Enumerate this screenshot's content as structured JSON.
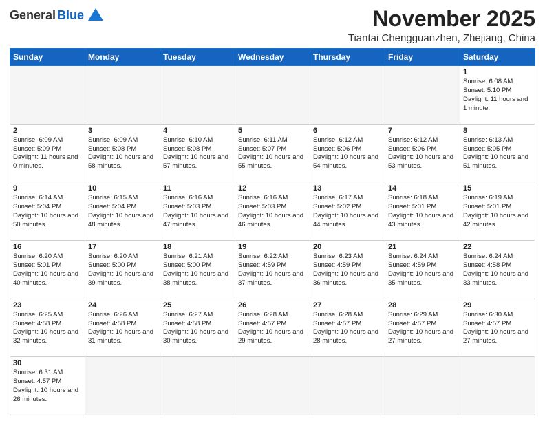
{
  "logo": {
    "general": "General",
    "blue": "Blue"
  },
  "header": {
    "month": "November 2025",
    "location": "Tiantai Chengguanzhen, Zhejiang, China"
  },
  "weekdays": [
    "Sunday",
    "Monday",
    "Tuesday",
    "Wednesday",
    "Thursday",
    "Friday",
    "Saturday"
  ],
  "weeks": [
    [
      {
        "day": "",
        "info": ""
      },
      {
        "day": "",
        "info": ""
      },
      {
        "day": "",
        "info": ""
      },
      {
        "day": "",
        "info": ""
      },
      {
        "day": "",
        "info": ""
      },
      {
        "day": "",
        "info": ""
      },
      {
        "day": "1",
        "info": "Sunrise: 6:08 AM\nSunset: 5:10 PM\nDaylight: 11 hours and 1 minute."
      }
    ],
    [
      {
        "day": "2",
        "info": "Sunrise: 6:09 AM\nSunset: 5:09 PM\nDaylight: 11 hours and 0 minutes."
      },
      {
        "day": "3",
        "info": "Sunrise: 6:09 AM\nSunset: 5:08 PM\nDaylight: 10 hours and 58 minutes."
      },
      {
        "day": "4",
        "info": "Sunrise: 6:10 AM\nSunset: 5:08 PM\nDaylight: 10 hours and 57 minutes."
      },
      {
        "day": "5",
        "info": "Sunrise: 6:11 AM\nSunset: 5:07 PM\nDaylight: 10 hours and 55 minutes."
      },
      {
        "day": "6",
        "info": "Sunrise: 6:12 AM\nSunset: 5:06 PM\nDaylight: 10 hours and 54 minutes."
      },
      {
        "day": "7",
        "info": "Sunrise: 6:12 AM\nSunset: 5:06 PM\nDaylight: 10 hours and 53 minutes."
      },
      {
        "day": "8",
        "info": "Sunrise: 6:13 AM\nSunset: 5:05 PM\nDaylight: 10 hours and 51 minutes."
      }
    ],
    [
      {
        "day": "9",
        "info": "Sunrise: 6:14 AM\nSunset: 5:04 PM\nDaylight: 10 hours and 50 minutes."
      },
      {
        "day": "10",
        "info": "Sunrise: 6:15 AM\nSunset: 5:04 PM\nDaylight: 10 hours and 48 minutes."
      },
      {
        "day": "11",
        "info": "Sunrise: 6:16 AM\nSunset: 5:03 PM\nDaylight: 10 hours and 47 minutes."
      },
      {
        "day": "12",
        "info": "Sunrise: 6:16 AM\nSunset: 5:03 PM\nDaylight: 10 hours and 46 minutes."
      },
      {
        "day": "13",
        "info": "Sunrise: 6:17 AM\nSunset: 5:02 PM\nDaylight: 10 hours and 44 minutes."
      },
      {
        "day": "14",
        "info": "Sunrise: 6:18 AM\nSunset: 5:01 PM\nDaylight: 10 hours and 43 minutes."
      },
      {
        "day": "15",
        "info": "Sunrise: 6:19 AM\nSunset: 5:01 PM\nDaylight: 10 hours and 42 minutes."
      }
    ],
    [
      {
        "day": "16",
        "info": "Sunrise: 6:20 AM\nSunset: 5:01 PM\nDaylight: 10 hours and 40 minutes."
      },
      {
        "day": "17",
        "info": "Sunrise: 6:20 AM\nSunset: 5:00 PM\nDaylight: 10 hours and 39 minutes."
      },
      {
        "day": "18",
        "info": "Sunrise: 6:21 AM\nSunset: 5:00 PM\nDaylight: 10 hours and 38 minutes."
      },
      {
        "day": "19",
        "info": "Sunrise: 6:22 AM\nSunset: 4:59 PM\nDaylight: 10 hours and 37 minutes."
      },
      {
        "day": "20",
        "info": "Sunrise: 6:23 AM\nSunset: 4:59 PM\nDaylight: 10 hours and 36 minutes."
      },
      {
        "day": "21",
        "info": "Sunrise: 6:24 AM\nSunset: 4:59 PM\nDaylight: 10 hours and 35 minutes."
      },
      {
        "day": "22",
        "info": "Sunrise: 6:24 AM\nSunset: 4:58 PM\nDaylight: 10 hours and 33 minutes."
      }
    ],
    [
      {
        "day": "23",
        "info": "Sunrise: 6:25 AM\nSunset: 4:58 PM\nDaylight: 10 hours and 32 minutes."
      },
      {
        "day": "24",
        "info": "Sunrise: 6:26 AM\nSunset: 4:58 PM\nDaylight: 10 hours and 31 minutes."
      },
      {
        "day": "25",
        "info": "Sunrise: 6:27 AM\nSunset: 4:58 PM\nDaylight: 10 hours and 30 minutes."
      },
      {
        "day": "26",
        "info": "Sunrise: 6:28 AM\nSunset: 4:57 PM\nDaylight: 10 hours and 29 minutes."
      },
      {
        "day": "27",
        "info": "Sunrise: 6:28 AM\nSunset: 4:57 PM\nDaylight: 10 hours and 28 minutes."
      },
      {
        "day": "28",
        "info": "Sunrise: 6:29 AM\nSunset: 4:57 PM\nDaylight: 10 hours and 27 minutes."
      },
      {
        "day": "29",
        "info": "Sunrise: 6:30 AM\nSunset: 4:57 PM\nDaylight: 10 hours and 27 minutes."
      }
    ],
    [
      {
        "day": "30",
        "info": "Sunrise: 6:31 AM\nSunset: 4:57 PM\nDaylight: 10 hours and 26 minutes."
      },
      {
        "day": "",
        "info": ""
      },
      {
        "day": "",
        "info": ""
      },
      {
        "day": "",
        "info": ""
      },
      {
        "day": "",
        "info": ""
      },
      {
        "day": "",
        "info": ""
      },
      {
        "day": "",
        "info": ""
      }
    ]
  ]
}
